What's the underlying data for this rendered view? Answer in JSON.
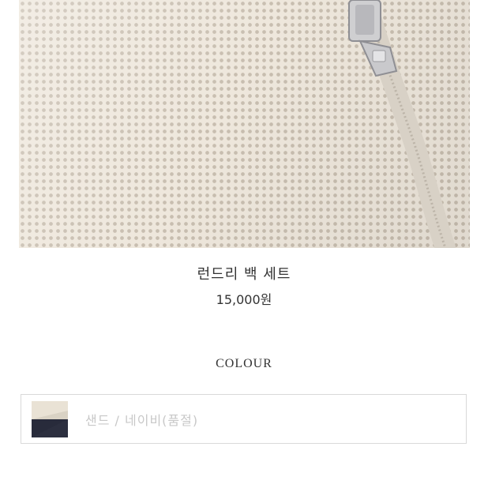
{
  "product": {
    "title": "런드리 백 세트",
    "price": "15,000원"
  },
  "options": {
    "heading": "COLOUR",
    "selected_label": "샌드 / 네이비(품절)",
    "swatch_colors": {
      "sand": "#e9e2d5",
      "navy": "#2c2f3f"
    }
  },
  "colors": {
    "mesh_background": "#eee7dc",
    "mesh_hole": "#c8beb0",
    "text": "#333333",
    "soldout_text": "#c8c8c8",
    "border": "#d9d9d9"
  }
}
